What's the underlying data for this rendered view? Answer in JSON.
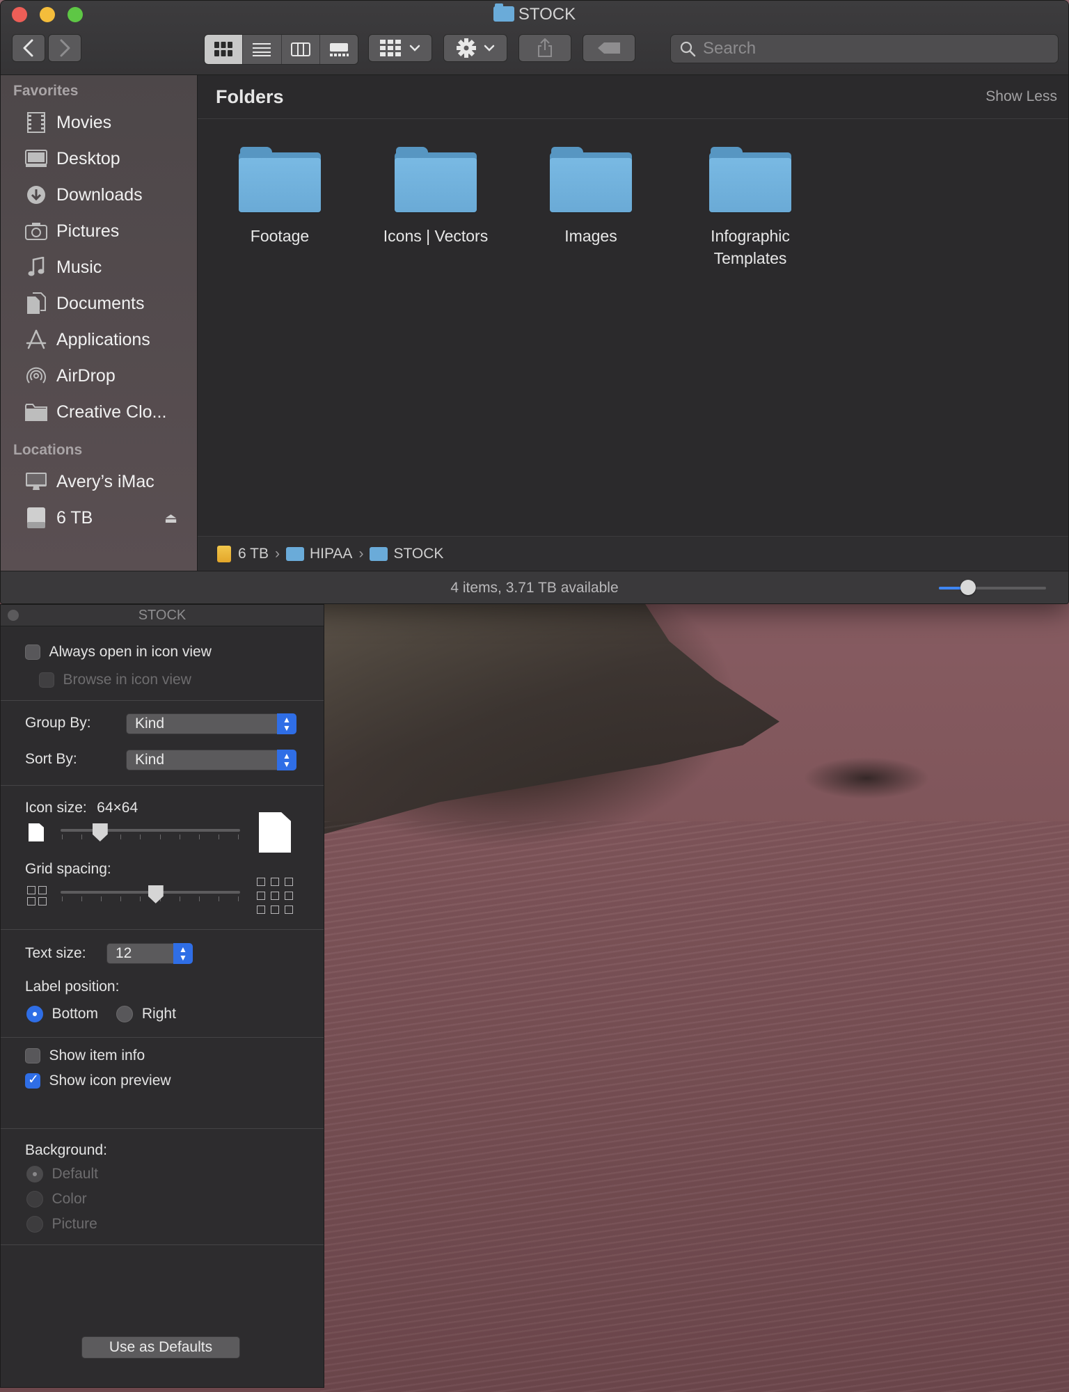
{
  "window": {
    "title": "STOCK",
    "toolbar": {
      "back_icon": "chevron-left-icon",
      "forward_icon": "chevron-right-icon",
      "view_modes": [
        "icon-view",
        "list-view",
        "column-view",
        "gallery-view"
      ],
      "active_view": "icon-view",
      "group_icon": "group-grid-icon",
      "action_icon": "gear-icon",
      "share_icon": "share-icon",
      "tag_icon": "tag-icon",
      "search_placeholder": "Search"
    }
  },
  "sidebar": {
    "favorites_header": "Favorites",
    "favorites": [
      {
        "label": "Movies",
        "icon": "film-icon"
      },
      {
        "label": "Desktop",
        "icon": "desktop-icon"
      },
      {
        "label": "Downloads",
        "icon": "download-icon"
      },
      {
        "label": "Pictures",
        "icon": "camera-icon"
      },
      {
        "label": "Music",
        "icon": "music-note-icon"
      },
      {
        "label": "Documents",
        "icon": "document-icon"
      },
      {
        "label": "Applications",
        "icon": "applications-icon"
      },
      {
        "label": "AirDrop",
        "icon": "airdrop-icon"
      },
      {
        "label": "Creative Clo...",
        "icon": "folder-icon"
      }
    ],
    "locations_header": "Locations",
    "locations": [
      {
        "label": "Avery’s iMac",
        "icon": "imac-icon"
      },
      {
        "label": "6 TB",
        "icon": "drive-icon",
        "eject_icon": "eject-icon"
      }
    ]
  },
  "content": {
    "section_title": "Folders",
    "show_less": "Show Less",
    "folders": [
      {
        "name": "Footage"
      },
      {
        "name": "Icons | Vectors"
      },
      {
        "name": "Images"
      },
      {
        "name": "Infographic Templates"
      }
    ]
  },
  "pathbar": {
    "items": [
      "6 TB",
      "HIPAA",
      "STOCK"
    ],
    "separator": "›"
  },
  "statusbar": {
    "text": "4 items, 3.71 TB available",
    "zoom_level": 0.2
  },
  "view_options": {
    "title": "STOCK",
    "always_open_icon_view": {
      "label": "Always open in icon view",
      "checked": false
    },
    "browse_icon_view": {
      "label": "Browse in icon view",
      "checked": false,
      "enabled": false
    },
    "group_by": {
      "label": "Group By:",
      "value": "Kind"
    },
    "sort_by": {
      "label": "Sort By:",
      "value": "Kind"
    },
    "icon_size": {
      "label": "Icon size:",
      "value": "64×64",
      "level": 0.22
    },
    "grid_spacing": {
      "label": "Grid spacing:",
      "level": 0.53
    },
    "text_size": {
      "label": "Text size:",
      "value": "12"
    },
    "label_position": {
      "label": "Label position:",
      "options": [
        "Bottom",
        "Right"
      ],
      "selected": "Bottom"
    },
    "show_item_info": {
      "label": "Show item info",
      "checked": false
    },
    "show_icon_preview": {
      "label": "Show icon preview",
      "checked": true
    },
    "background": {
      "label": "Background:",
      "options": [
        "Default",
        "Color",
        "Picture"
      ],
      "selected": "Default",
      "enabled": false
    },
    "defaults_button": "Use as Defaults"
  },
  "colors": {
    "accent": "#2f6ee6",
    "folder": "#6aabd9",
    "window_bg": "#2b2a2c"
  }
}
